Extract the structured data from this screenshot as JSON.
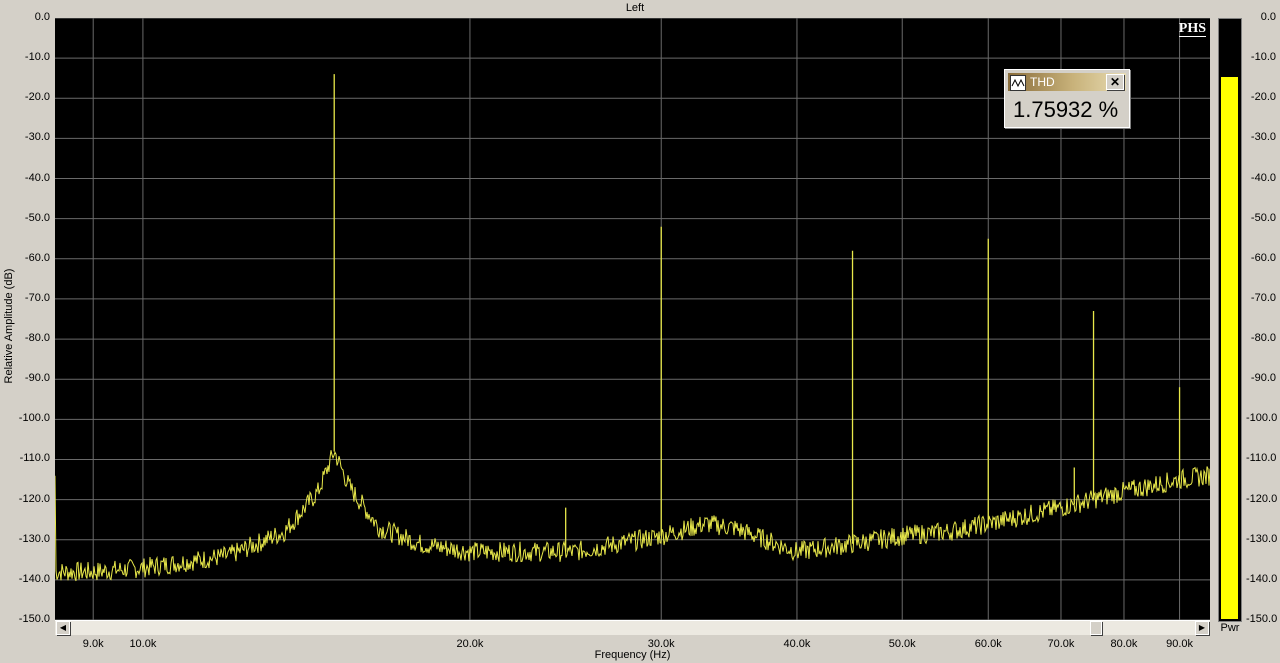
{
  "chart_data": {
    "type": "line",
    "title": "Left",
    "xlabel": "Frequency (Hz)",
    "ylabel": "Relative Amplitude (dB)",
    "xscale": "log",
    "xlim": [
      8300,
      96000
    ],
    "ylim": [
      -150,
      0
    ],
    "x_ticks": [
      "9.0k",
      "10.0k",
      "20.0k",
      "30.0k",
      "40.0k",
      "50.0k",
      "60.0k",
      "70.0k",
      "80.0k",
      "90.0k"
    ],
    "x_tick_values": [
      9000,
      10000,
      20000,
      30000,
      40000,
      50000,
      60000,
      70000,
      80000,
      90000
    ],
    "y_ticks": [
      "0.0",
      "-10.0",
      "-20.0",
      "-30.0",
      "-40.0",
      "-50.0",
      "-60.0",
      "-70.0",
      "-80.0",
      "-90.0",
      "-100.0",
      "-110.0",
      "-120.0",
      "-130.0",
      "-140.0",
      "-150.0"
    ],
    "y_tick_values": [
      0,
      -10,
      -20,
      -30,
      -40,
      -50,
      -60,
      -70,
      -80,
      -90,
      -100,
      -110,
      -120,
      -130,
      -140,
      -150
    ],
    "grid": true,
    "series": [
      {
        "color": "#e8e84a",
        "noise_floor": {
          "x": [
            8300,
            9000,
            10000,
            12000,
            13500,
            14500,
            15000,
            15500,
            16500,
            18000,
            20000,
            25000,
            30000,
            33000,
            35000,
            40000,
            45000,
            50000,
            55000,
            60000,
            70000,
            80000,
            90000,
            96000
          ],
          "y": [
            -138,
            -138,
            -137,
            -134,
            -128,
            -118,
            -108,
            -117,
            -127,
            -131,
            -133,
            -133,
            -129,
            -126,
            -127,
            -133,
            -131,
            -129,
            -128,
            -126,
            -122,
            -118,
            -115,
            -114
          ]
        },
        "peaks": [
          {
            "x": 15000,
            "y": -14
          },
          {
            "x": 24500,
            "y": -122
          },
          {
            "x": 30000,
            "y": -52
          },
          {
            "x": 45000,
            "y": -58
          },
          {
            "x": 60000,
            "y": -55
          },
          {
            "x": 72000,
            "y": -112
          },
          {
            "x": 75000,
            "y": -73
          },
          {
            "x": 90000,
            "y": -92
          }
        ]
      }
    ]
  },
  "brand": "PHS",
  "thd_widget": {
    "label": "THD",
    "value": "1.75932 %",
    "close": "✕"
  },
  "meter": {
    "label": "Pwr",
    "level_db": -14,
    "ticks": [
      "0.0",
      "-10.0",
      "-20.0",
      "-30.0",
      "-40.0",
      "-50.0",
      "-60.0",
      "-70.0",
      "-80.0",
      "-90.0",
      "-100.0",
      "-110.0",
      "-120.0",
      "-130.0",
      "-140.0",
      "-150.0"
    ],
    "fill_color": "#ffff00"
  },
  "scrollbar": {
    "left_arrow": "◀",
    "right_arrow": "▶"
  }
}
